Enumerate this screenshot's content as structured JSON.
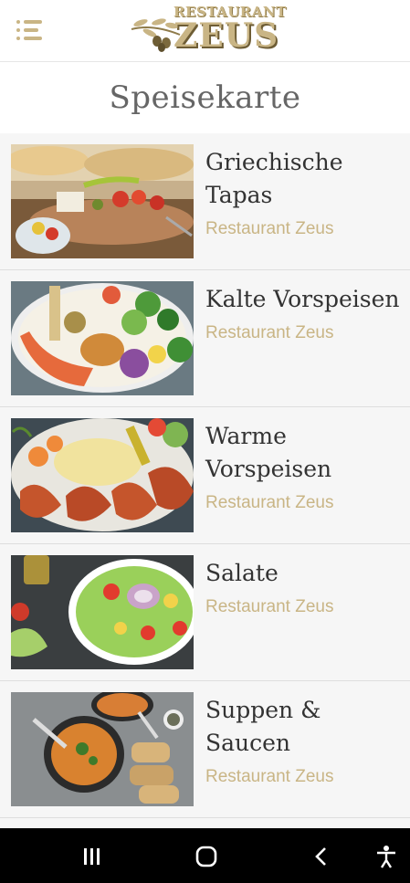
{
  "header": {
    "menu_icon": "hamburger-menu-icon",
    "logo_top_text": "RESTAURANT",
    "logo_main_text": "ZEUS",
    "accent_color": "#c9b585"
  },
  "page_title": "Speisekarte",
  "categories": [
    {
      "title_line1": "Griechische",
      "title_line2": "Tapas",
      "subtitle": "Restaurant Zeus"
    },
    {
      "title_line1": "Kalte Vorspeisen",
      "title_line2": "",
      "subtitle": "Restaurant Zeus"
    },
    {
      "title_line1": "Warme",
      "title_line2": "Vorspeisen",
      "subtitle": "Restaurant Zeus"
    },
    {
      "title_line1": "Salate",
      "title_line2": "",
      "subtitle": "Restaurant Zeus"
    },
    {
      "title_line1": "Suppen &",
      "title_line2": "Saucen",
      "subtitle": "Restaurant Zeus"
    }
  ],
  "system_nav": {
    "recents_icon": "recent-apps-icon",
    "home_icon": "home-icon",
    "back_icon": "back-icon",
    "accessibility_icon": "accessibility-icon"
  }
}
